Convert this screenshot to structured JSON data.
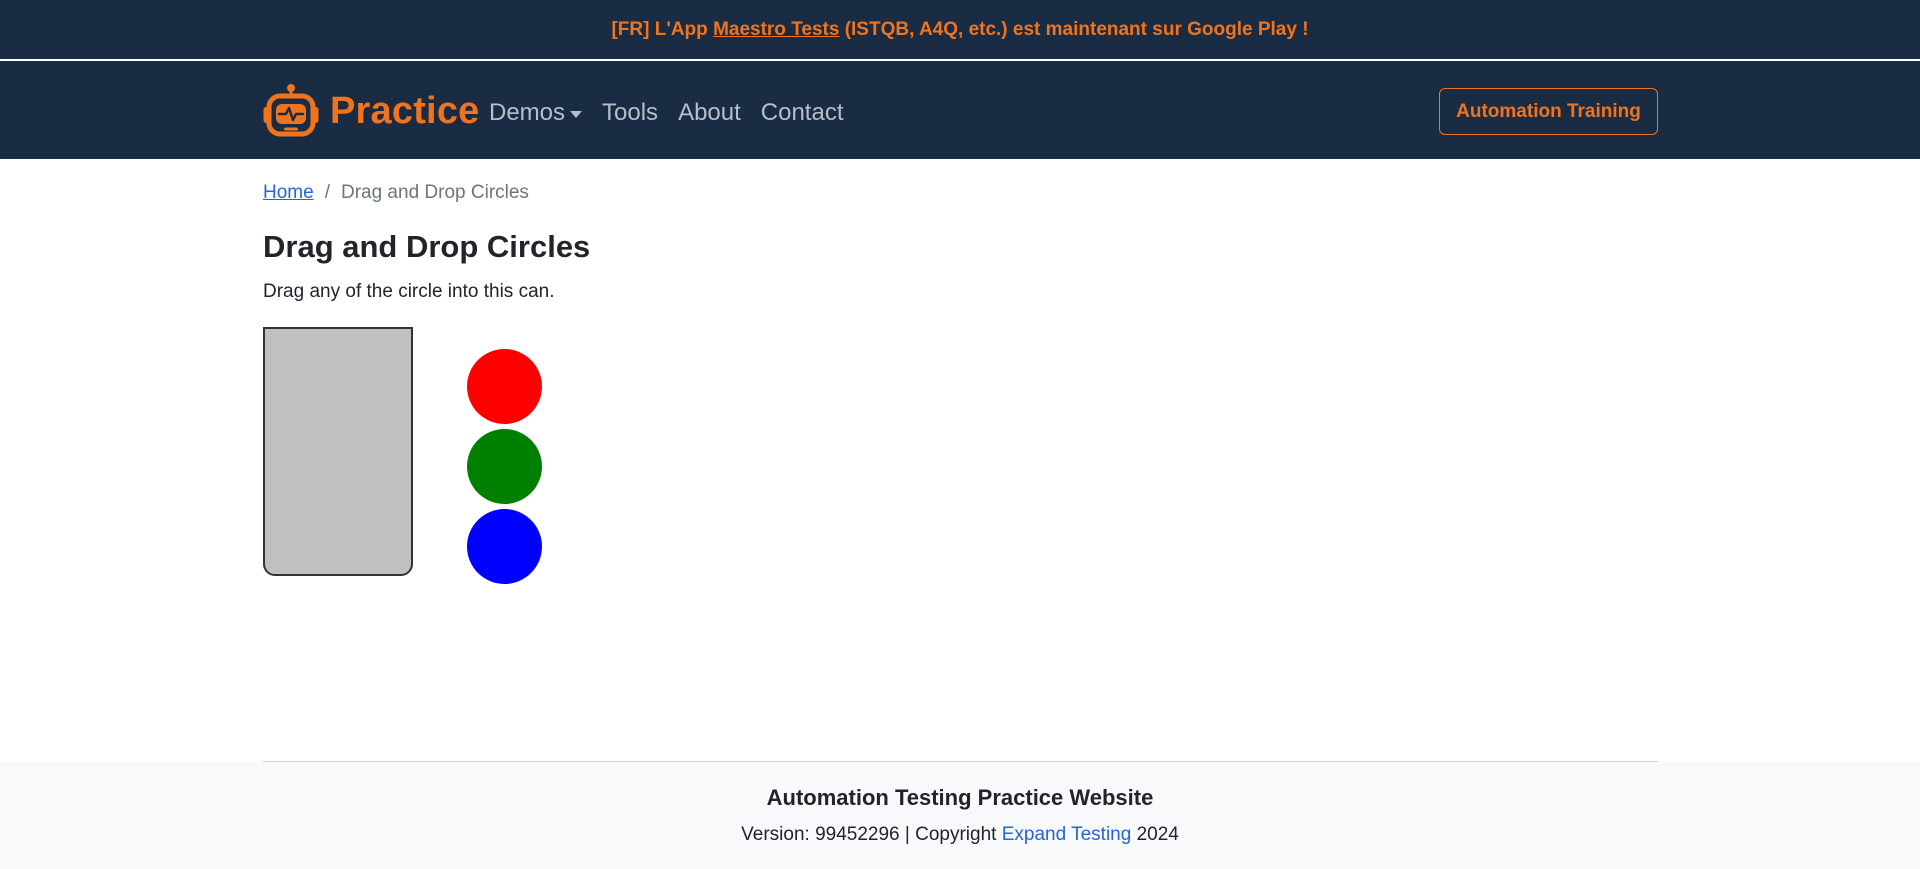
{
  "announcement": {
    "prefix": "[FR] L'App ",
    "link_text": "Maestro Tests",
    "suffix": " (ISTQB, A4Q, etc.) est maintenant sur Google Play !"
  },
  "navbar": {
    "brand": "Practice",
    "logo_icon": "robot-icon",
    "links": [
      {
        "label": "Demos",
        "has_dropdown": true
      },
      {
        "label": "Tools"
      },
      {
        "label": "About"
      },
      {
        "label": "Contact"
      }
    ],
    "cta_label": "Automation Training"
  },
  "breadcrumb": {
    "home": "Home",
    "separator": "/",
    "current": "Drag and Drop Circles"
  },
  "main": {
    "title": "Drag and Drop Circles",
    "instructions": "Drag any of the circle into this can.",
    "circles": [
      {
        "color": "#ff0000"
      },
      {
        "color": "#008000"
      },
      {
        "color": "#0000ff"
      }
    ]
  },
  "footer": {
    "title": "Automation Testing Practice Website",
    "version_prefix": "Version: 99452296 | Copyright ",
    "company_link": "Expand Testing",
    "year": " 2024"
  },
  "colors": {
    "nav_bg": "#192c44",
    "accent": "#f0731d",
    "link": "#2565d8",
    "can_fill": "#c0c0c0"
  }
}
